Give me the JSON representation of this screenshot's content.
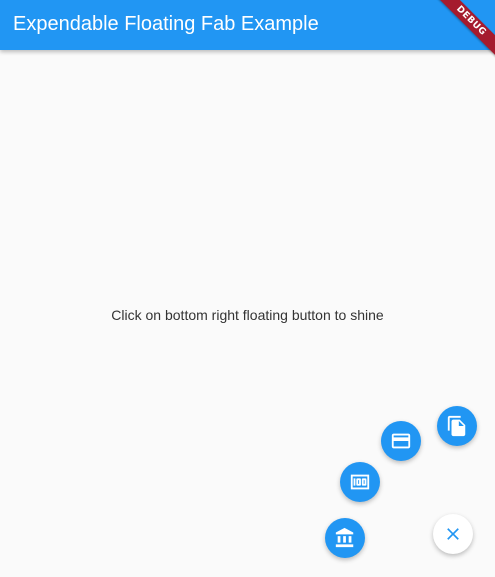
{
  "appbar": {
    "title": "Expendable Floating Fab Example",
    "color": "#2196f3"
  },
  "debug_banner": {
    "label": "DEBUG",
    "color": "#a51b2e"
  },
  "body": {
    "message": "Click on bottom right floating button to shine"
  },
  "fab_menu": {
    "accent": "#2196f3",
    "items": [
      {
        "icon": "file-copy-icon"
      },
      {
        "icon": "credit-card-icon"
      },
      {
        "icon": "money-icon"
      },
      {
        "icon": "bank-icon"
      }
    ],
    "main_button": {
      "icon": "close-icon",
      "state": "expanded"
    }
  }
}
